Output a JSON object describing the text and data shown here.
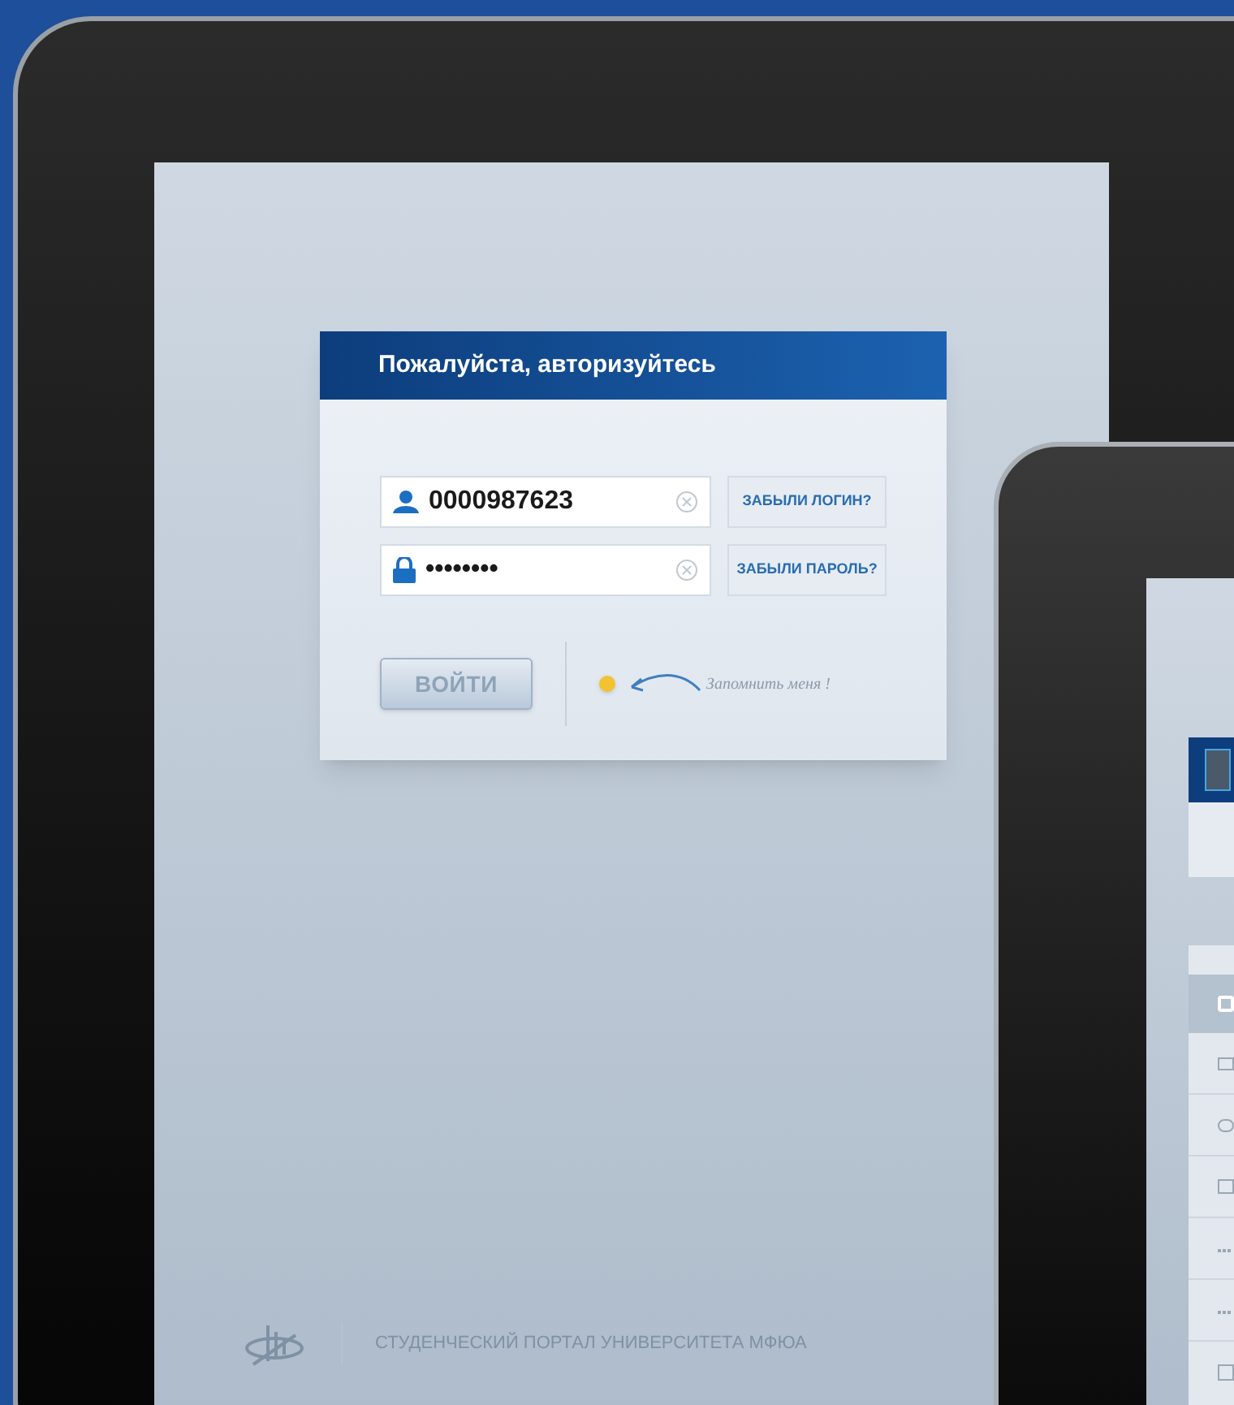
{
  "login": {
    "title": "Пожалуйста, авторизуйтесь",
    "fields": [
      {
        "kind": "login",
        "value": "0000987623",
        "link": "ЗАБЫЛИ ЛОГИН?"
      },
      {
        "kind": "password",
        "value": "••••••••",
        "link": "ЗАБЫЛИ ПАРОЛЬ?"
      }
    ],
    "submit": "ВОЙТИ",
    "remember": {
      "label": "Запомнить меня !",
      "checked": true
    }
  },
  "footer": {
    "text": "СТУДЕНЧЕСКИЙ ПОРТАЛ УНИВЕРСИТЕТА МФЮА"
  }
}
